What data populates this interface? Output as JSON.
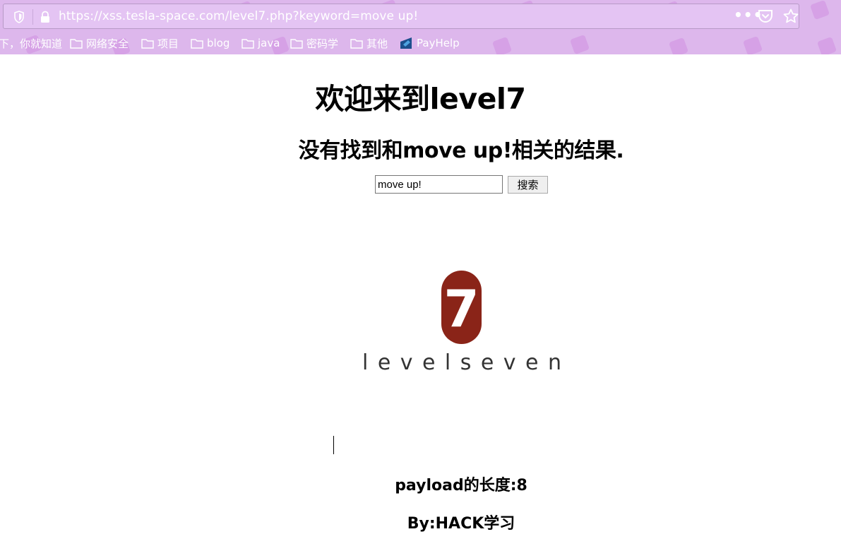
{
  "browser": {
    "url": "https://xss.tesla-space.com/level7.php?keyword=move up!",
    "menu_dots": "•••",
    "bookmarks": [
      {
        "label": "下，你就知道",
        "icon": "none"
      },
      {
        "label": "网络安全",
        "icon": "folder-icon"
      },
      {
        "label": "项目",
        "icon": "folder-icon"
      },
      {
        "label": "blog",
        "icon": "folder-icon"
      },
      {
        "label": "java",
        "icon": "folder-icon"
      },
      {
        "label": "密码学",
        "icon": "folder-icon"
      },
      {
        "label": "其他",
        "icon": "folder-icon"
      },
      {
        "label": "PayHelp",
        "icon": "payhelp-icon"
      }
    ],
    "theme_color": "#ddb7ec"
  },
  "page": {
    "title": "欢迎来到level7",
    "subtitle": "没有找到和move up!相关的结果.",
    "search": {
      "value": "move up!",
      "button_label": "搜索"
    },
    "logo": {
      "number": "7",
      "wordmark": "levelseven",
      "badge_color": "#8a2418"
    },
    "payload_length": "payload的长度:8",
    "author": "By:HACK学习"
  }
}
